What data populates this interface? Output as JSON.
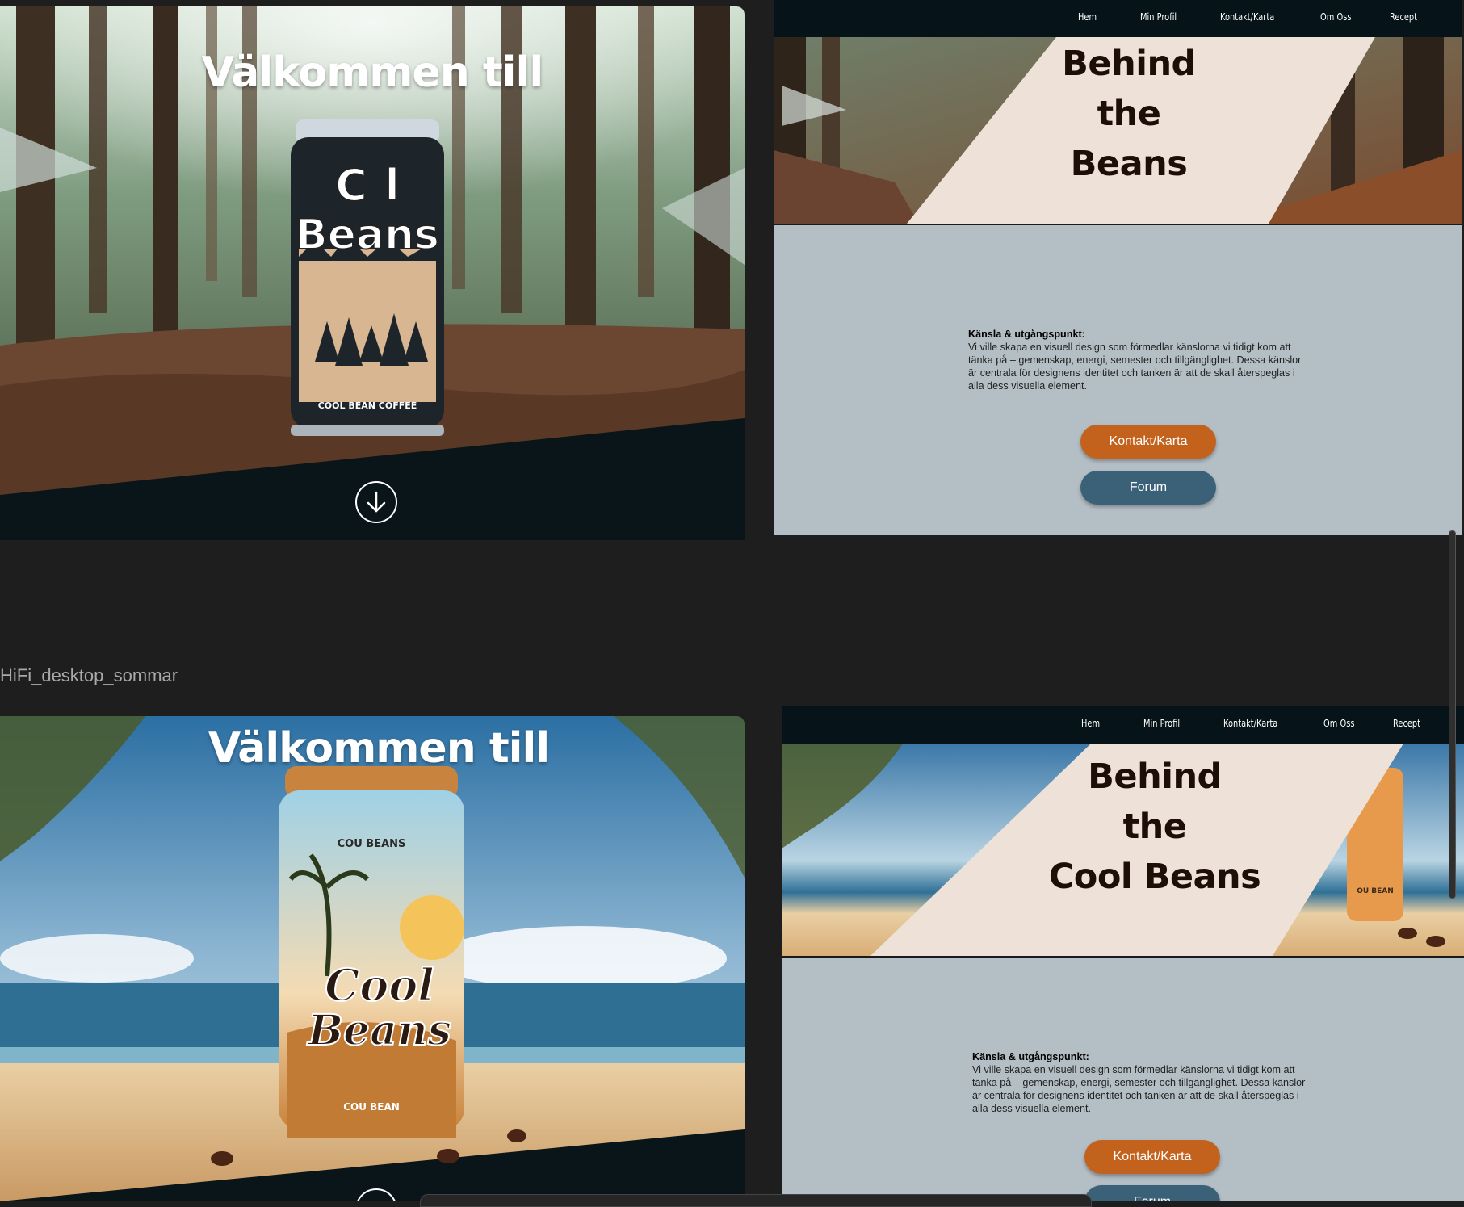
{
  "hero_winter": {
    "title": "Välkommen till",
    "can": {
      "brand_line1": "C  l",
      "brand_line2": "Beans",
      "subtitle": "COOL BEAN COFFEE"
    }
  },
  "hero_summer": {
    "title": "Välkommen till",
    "can": {
      "top_text": "COU BEANS",
      "brand_line1": "Cool",
      "brand_line2": "Beans",
      "bottom_text": "COU BEAN"
    }
  },
  "frame_label": "HiFi_desktop_sommar",
  "about_winter": {
    "nav": [
      "Hem",
      "Min Profil",
      "Kontakt/Karta",
      "Om Oss",
      "Recept"
    ],
    "banner_lines": [
      "Behind",
      "the",
      "Beans"
    ],
    "heading": "Känsla & utgångspunkt:",
    "body_lines": [
      "Vi ville skapa en visuell design som förmedlar känslorna vi tidigt kom att",
      "tänka på – gemenskap, energi, semester och tillgänglighet. Dessa känslor",
      "är centrala för designens identitet och tanken är att de skall återspeglas i",
      "alla dess visuella element."
    ],
    "buttons": [
      "Kontakt/Karta",
      "Forum"
    ]
  },
  "about_summer": {
    "nav": [
      "Hem",
      "Min Profil",
      "Kontakt/Karta",
      "Om Oss",
      "Recept"
    ],
    "banner_lines": [
      "Behind",
      "the",
      "Cool Beans"
    ],
    "heading": "Känsla & utgångspunkt:",
    "body_lines": [
      "Vi ville skapa en visuell design som förmedlar känslorna vi tidigt kom att",
      "tänka på – gemenskap, energi, semester och tillgänglighet. Dessa känslor",
      "är centrala för designens identitet och tanken är att de skall återspeglas i",
      "alla dess visuella element."
    ],
    "buttons": [
      "Kontakt/Karta",
      "Forum"
    ],
    "can_label": "OU BEAN"
  },
  "colors": {
    "page_bg": "#1e1e1e",
    "dark_band": "#0a1519",
    "nav_bg": "#061419",
    "banner_panel": "#ede1d8",
    "content_bg": "#b4bec5",
    "button_orange": "#c2621c",
    "button_blue": "#3b6179"
  }
}
